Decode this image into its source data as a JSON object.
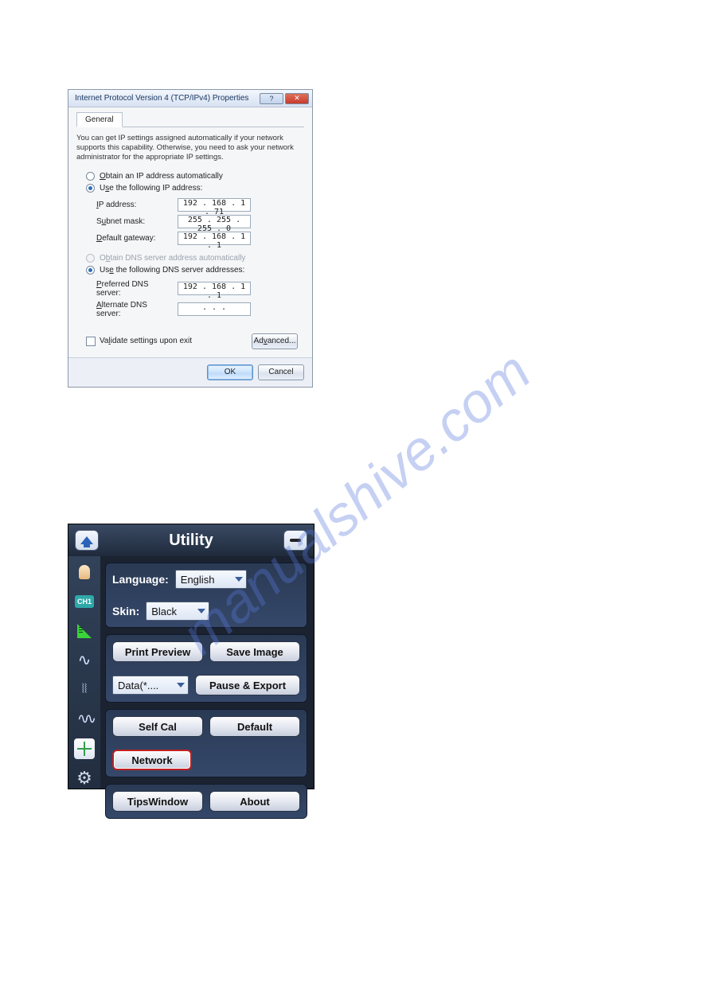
{
  "watermark": "manualshive.com",
  "ipv4": {
    "title": "Internet Protocol Version 4 (TCP/IPv4) Properties",
    "tab_general": "General",
    "helptext": "You can get IP settings assigned automatically if your network supports this capability. Otherwise, you need to ask your network administrator for the appropriate IP settings.",
    "radio_auto_ip": "Obtain an IP address automatically",
    "radio_use_ip": "Use the following IP address:",
    "lbl_ip": "IP address:",
    "val_ip": "192 . 168 .  1  . 71",
    "lbl_subnet": "Subnet mask:",
    "val_subnet": "255 . 255 . 255 .  0",
    "lbl_gateway": "Default gateway:",
    "val_gateway": "192 . 168 .  1  .  1",
    "radio_auto_dns": "Obtain DNS server address automatically",
    "radio_use_dns": "Use the following DNS server addresses:",
    "lbl_pref_dns": "Preferred DNS server:",
    "val_pref_dns": "192 . 168 .  1  .  1",
    "lbl_alt_dns": "Alternate DNS server:",
    "val_alt_dns": " .       .       . ",
    "validate": "Validate settings upon exit",
    "btn_advanced": "Advanced...",
    "btn_ok": "OK",
    "btn_cancel": "Cancel"
  },
  "util": {
    "title": "Utility",
    "language_label": "Language:",
    "language_value": "English",
    "skin_label": "Skin:",
    "skin_value": "Black",
    "btn_print_preview": "Print Preview",
    "btn_save_image": "Save Image",
    "data_dd": "Data(*....",
    "btn_pause_export": "Pause & Export",
    "btn_self_cal": "Self Cal",
    "btn_default": "Default",
    "btn_network": "Network",
    "btn_tips": "TipsWindow",
    "btn_about": "About",
    "side_ch1": "CH1"
  }
}
